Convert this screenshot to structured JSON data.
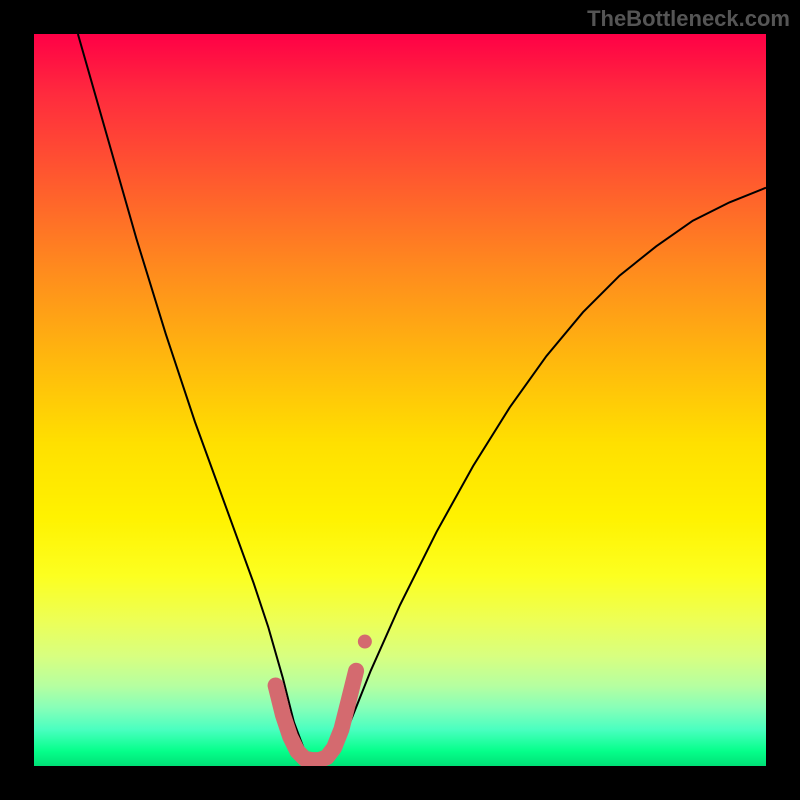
{
  "watermark": "TheBottleneck.com",
  "chart_data": {
    "type": "line",
    "title": "",
    "xlabel": "",
    "ylabel": "",
    "xlim": [
      0,
      100
    ],
    "ylim": [
      0,
      100
    ],
    "series": [
      {
        "name": "bottleneck-curve",
        "x": [
          6,
          10,
          14,
          18,
          22,
          26,
          30,
          32,
          34,
          35.5,
          37,
          38.5,
          40,
          42,
          44,
          46,
          50,
          55,
          60,
          65,
          70,
          75,
          80,
          85,
          90,
          95,
          100
        ],
        "y": [
          100,
          86,
          72,
          59,
          47,
          36,
          25,
          19,
          12,
          6,
          2,
          0.5,
          0.5,
          3,
          8,
          13,
          22,
          32,
          41,
          49,
          56,
          62,
          67,
          71,
          74.5,
          77,
          79
        ]
      }
    ],
    "annotations": [
      {
        "name": "flat-segment",
        "type": "thick-dot-run",
        "color": "#d46a6f",
        "x": [
          33,
          34,
          35,
          36,
          37,
          38,
          39,
          40,
          41,
          42,
          43,
          44
        ],
        "y": [
          11,
          7,
          4,
          2,
          1,
          0.8,
          0.8,
          1.2,
          2.5,
          5,
          9,
          13
        ]
      }
    ],
    "grid": false,
    "legend": false
  }
}
